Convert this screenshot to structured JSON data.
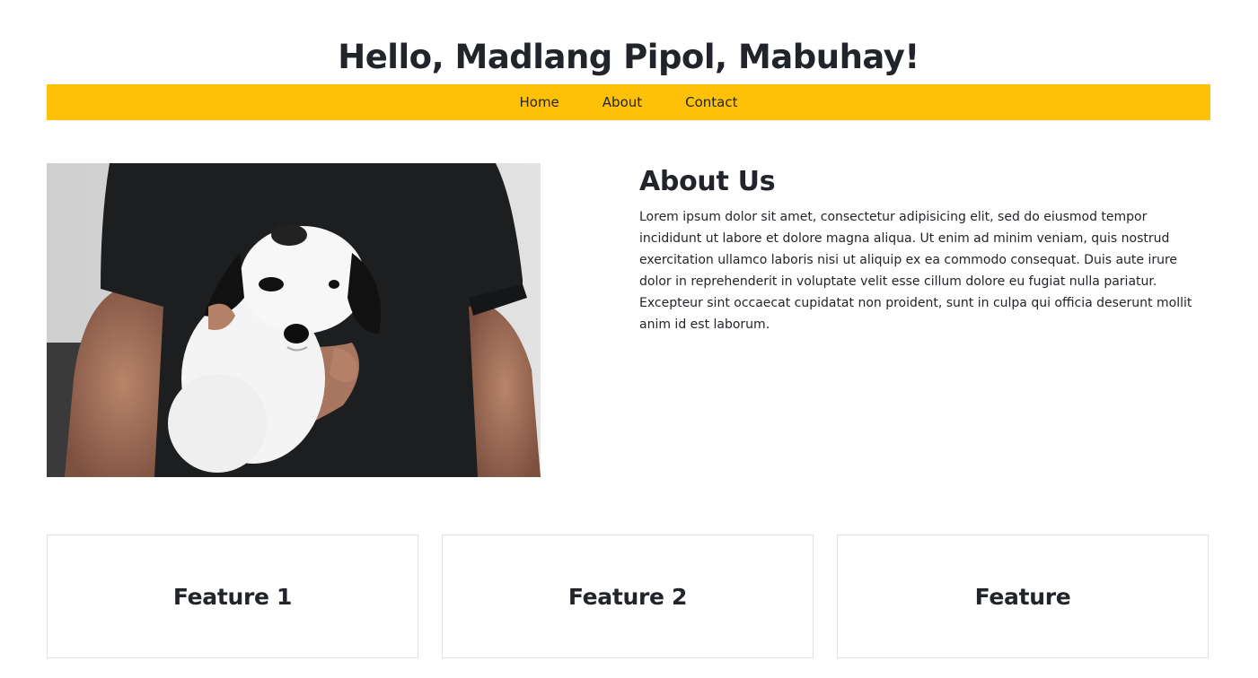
{
  "header": {
    "title": "Hello, Madlang Pipol, Mabuhay!"
  },
  "nav": {
    "items": [
      {
        "label": "Home"
      },
      {
        "label": "About"
      },
      {
        "label": "Contact"
      }
    ]
  },
  "about": {
    "title": "About Us",
    "body": "Lorem ipsum dolor sit amet, consectetur adipisicing elit, sed do eiusmod tempor incididunt ut labore et dolore magna aliqua. Ut enim ad minim veniam, quis nostrud exercitation ullamco laboris nisi ut aliquip ex ea commodo consequat. Duis aute irure dolor in reprehenderit in voluptate velit esse cillum dolore eu fugiat nulla pariatur. Excepteur sint occaecat cupidatat non proident, sunt in culpa qui officia deserunt mollit anim id est laborum."
  },
  "features": [
    {
      "title": "Feature 1"
    },
    {
      "title": "Feature 2"
    },
    {
      "title": "Feature"
    }
  ],
  "colors": {
    "nav_background": "#ffc107",
    "text": "#212529",
    "card_border": "#dee2e6"
  },
  "image": {
    "subject": "puppy-photo"
  }
}
